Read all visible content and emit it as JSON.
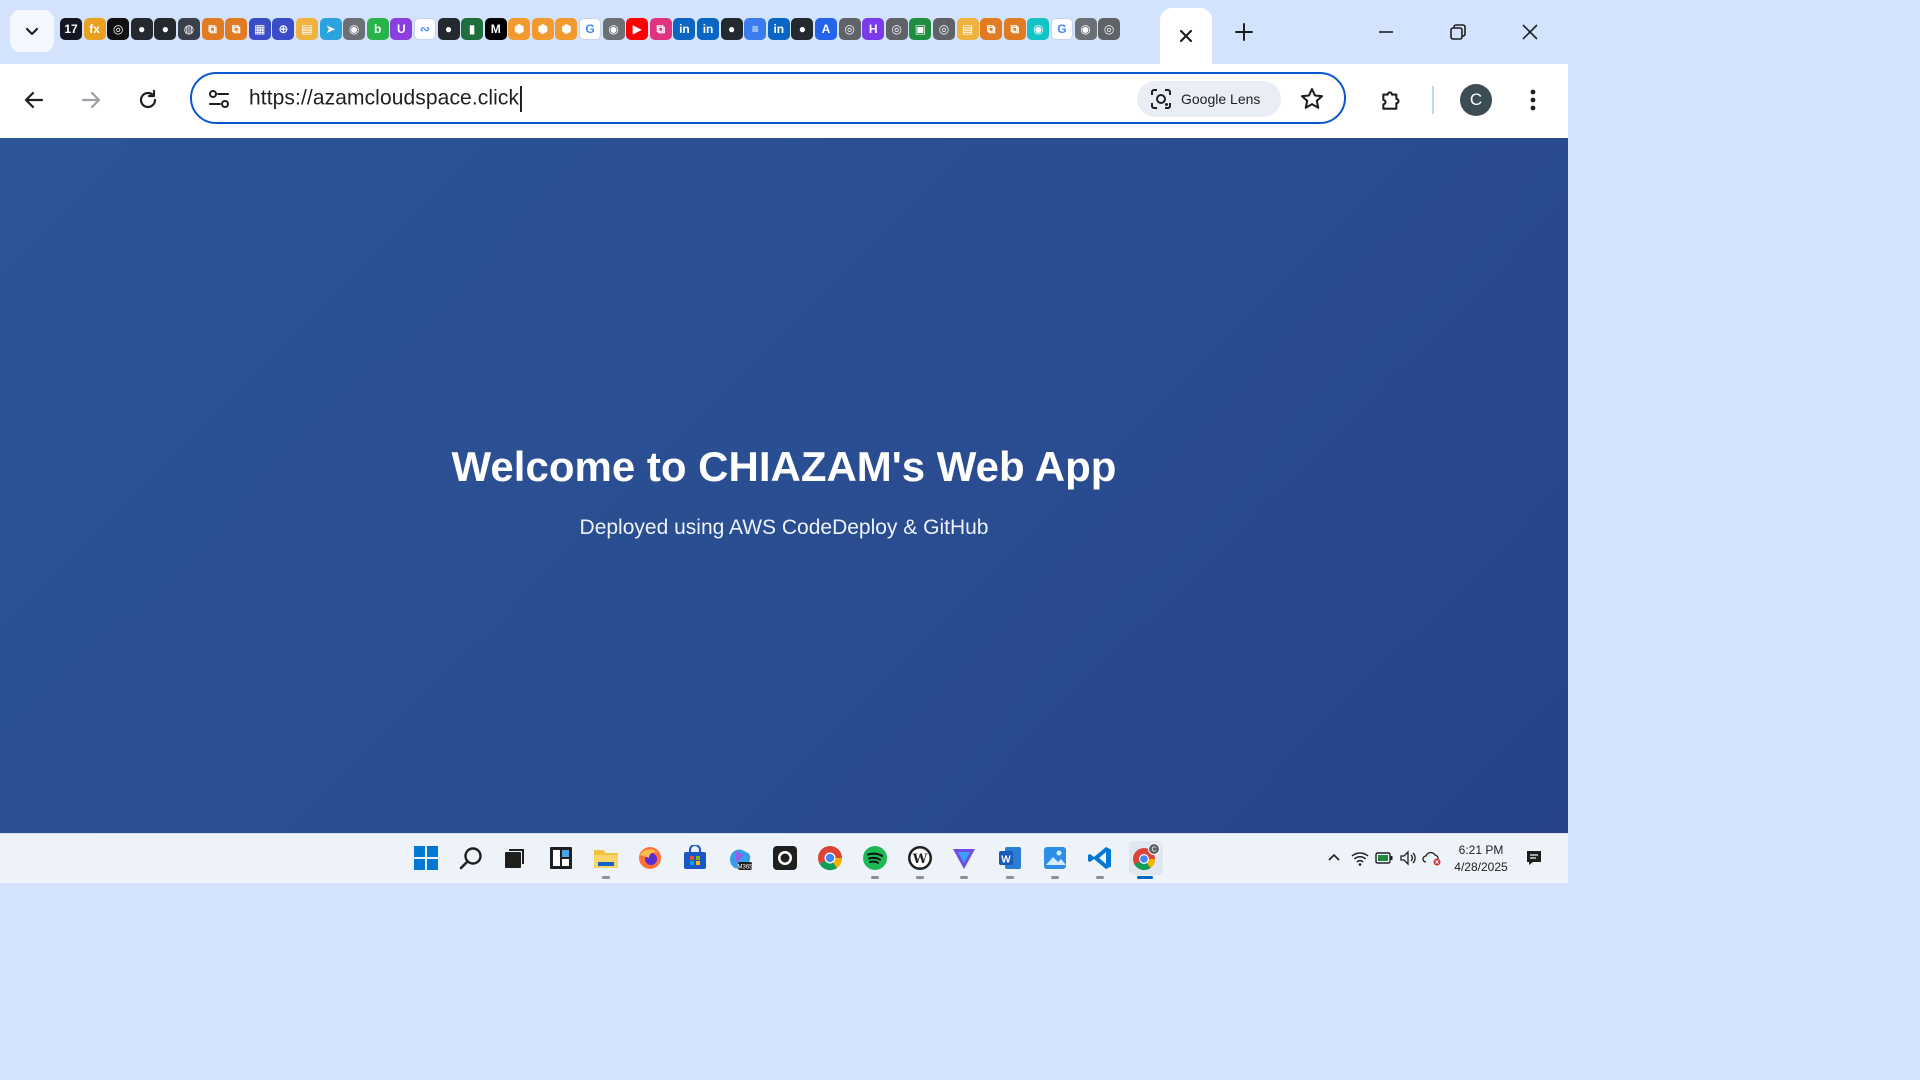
{
  "browser": {
    "url": "https://azamcloudspace.click",
    "lens_label": "Google Lens",
    "profile_initial": "C",
    "tab_favicons": [
      {
        "name": "tradingview-favicon",
        "bg": "#131722",
        "glyph": "17"
      },
      {
        "name": "fx-favicon",
        "bg": "#e8a021",
        "glyph": "fx"
      },
      {
        "name": "openai-favicon",
        "bg": "#111111",
        "glyph": "◎"
      },
      {
        "name": "github-favicon",
        "bg": "#24292f",
        "glyph": "●"
      },
      {
        "name": "github-favicon",
        "bg": "#24292f",
        "glyph": "●"
      },
      {
        "name": "copilot-favicon",
        "bg": "#3a3f4a",
        "glyph": "◍"
      },
      {
        "name": "aws-favicon",
        "bg": "#e07b22",
        "glyph": "⧉"
      },
      {
        "name": "aws-favicon",
        "bg": "#e07b22",
        "glyph": "⧉"
      },
      {
        "name": "storage-favicon",
        "bg": "#3a4cc8",
        "glyph": "▦"
      },
      {
        "name": "globe-favicon",
        "bg": "#3a4cc8",
        "glyph": "⊕"
      },
      {
        "name": "box-favicon",
        "bg": "#f0b23e",
        "glyph": "▤"
      },
      {
        "name": "telegram-favicon",
        "bg": "#2aa3de",
        "glyph": "➤"
      },
      {
        "name": "site-favicon",
        "bg": "#6b6f76",
        "glyph": "◉"
      },
      {
        "name": "b-favicon",
        "bg": "#2bb34b",
        "glyph": "b"
      },
      {
        "name": "u-favicon",
        "bg": "#8c3fe0",
        "glyph": "U"
      },
      {
        "name": "wave-favicon",
        "bg": "#ffffff",
        "glyph": "∾"
      },
      {
        "name": "github-favicon",
        "bg": "#24292f",
        "glyph": "●"
      },
      {
        "name": "green-favicon",
        "bg": "#1f6f3d",
        "glyph": "▮"
      },
      {
        "name": "medium-favicon",
        "bg": "#000000",
        "glyph": "M"
      },
      {
        "name": "cube-favicon",
        "bg": "#f29a2e",
        "glyph": "⬢"
      },
      {
        "name": "cube-favicon",
        "bg": "#f29a2e",
        "glyph": "⬢"
      },
      {
        "name": "cube-favicon",
        "bg": "#f29a2e",
        "glyph": "⬢"
      },
      {
        "name": "google-favicon",
        "bg": "#ffffff",
        "glyph": "G"
      },
      {
        "name": "site-favicon",
        "bg": "#6b6f76",
        "glyph": "◉"
      },
      {
        "name": "youtube-favicon",
        "bg": "#ff0000",
        "glyph": "▶"
      },
      {
        "name": "pink-favicon",
        "bg": "#e0337e",
        "glyph": "⧉"
      },
      {
        "name": "linkedin-favicon",
        "bg": "#0a66c2",
        "glyph": "in"
      },
      {
        "name": "linkedin-favicon",
        "bg": "#0a66c2",
        "glyph": "in"
      },
      {
        "name": "github-favicon",
        "bg": "#24292f",
        "glyph": "●"
      },
      {
        "name": "docs-favicon",
        "bg": "#3b7ded",
        "glyph": "≡"
      },
      {
        "name": "linkedin-favicon",
        "bg": "#0a66c2",
        "glyph": "in"
      },
      {
        "name": "github-favicon",
        "bg": "#24292f",
        "glyph": "●"
      },
      {
        "name": "a-favicon",
        "bg": "#2563eb",
        "glyph": "A"
      },
      {
        "name": "chrome-favicon",
        "bg": "#5f6368",
        "glyph": "◎"
      },
      {
        "name": "h-favicon",
        "bg": "#7c3aed",
        "glyph": "H"
      },
      {
        "name": "chrome-favicon",
        "bg": "#5f6368",
        "glyph": "◎"
      },
      {
        "name": "sheet-favicon",
        "bg": "#1e8e3e",
        "glyph": "▣"
      },
      {
        "name": "chrome-favicon",
        "bg": "#5f6368",
        "glyph": "◎"
      },
      {
        "name": "box-favicon",
        "bg": "#f0b23e",
        "glyph": "▤"
      },
      {
        "name": "aws-favicon",
        "bg": "#e07b22",
        "glyph": "⧉"
      },
      {
        "name": "aws-favicon",
        "bg": "#e07b22",
        "glyph": "⧉"
      },
      {
        "name": "teal-favicon",
        "bg": "#12c4c4",
        "glyph": "◉"
      },
      {
        "name": "google-favicon",
        "bg": "#ffffff",
        "glyph": "G"
      },
      {
        "name": "site-favicon",
        "bg": "#6b6f76",
        "glyph": "◉"
      },
      {
        "name": "chrome-favicon",
        "bg": "#5f6368",
        "glyph": "◎"
      }
    ]
  },
  "page": {
    "title": "Welcome to CHIAZAM's Web App",
    "subtitle": "Deployed using AWS CodeDeploy & GitHub",
    "background_color": "#2a4d91"
  },
  "taskbar": {
    "time": "6:21 PM",
    "date": "4/28/2025"
  }
}
